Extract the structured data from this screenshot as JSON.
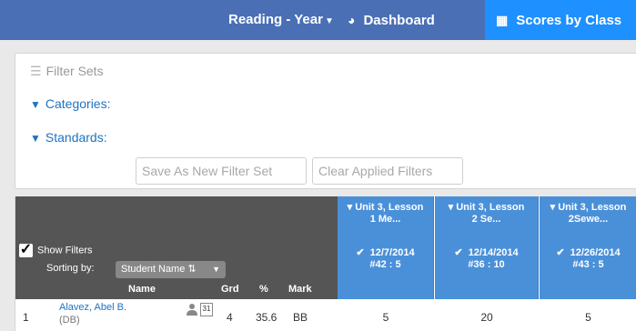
{
  "nav": {
    "year_label": "Reading - Year",
    "dashboard_label": "Dashboard",
    "scores_label": "Scores by Class"
  },
  "filters": {
    "filter_sets": "Filter Sets",
    "categories": "Categories:",
    "standards": "Standards:",
    "save_button": "Save As New Filter Set",
    "clear_button": "Clear Applied Filters"
  },
  "table": {
    "show_filters": "Show Filters",
    "sorting_by": "Sorting by:",
    "sort_value": "Student Name",
    "columns": {
      "name": "Name",
      "grd": "Grd",
      "pct": "%",
      "mark": "Mark"
    },
    "assignments": [
      {
        "title_line1": "Unit 3, Lesson",
        "title_line2": "1 Me...",
        "date": "12/7/2014",
        "code": "#42 : 5"
      },
      {
        "title_line1": "Unit 3, Lesson",
        "title_line2": "2 Se...",
        "date": "12/14/2014",
        "code": "#36 : 10"
      },
      {
        "title_line1": "Unit 3, Lesson",
        "title_line2": "2Sewe...",
        "date": "12/26/2014",
        "code": "#43 : 5"
      }
    ],
    "rows": [
      {
        "index": "1",
        "name": "Alavez, Abel B.",
        "sub": "(DB)",
        "cal": "31",
        "grd": "4",
        "pct": "35.6",
        "mark": "BB",
        "scores": [
          "5",
          "20",
          "5"
        ]
      }
    ]
  },
  "colors": {
    "topbar": "#4a6fb5",
    "active_tab": "#1e90ff",
    "assignment_header": "#4a90d9",
    "header_dark": "#555555",
    "link": "#1e73be"
  }
}
